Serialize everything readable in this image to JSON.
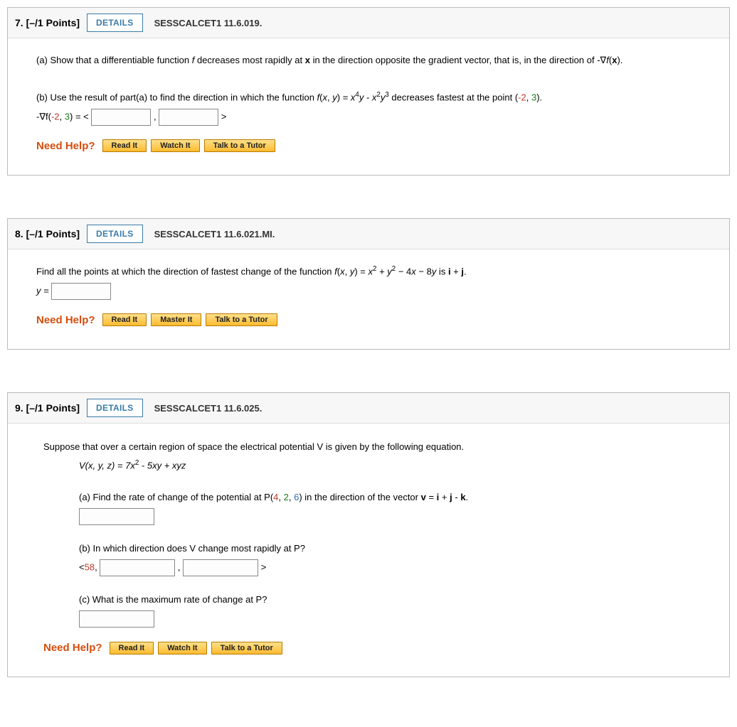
{
  "labels": {
    "details": "DETAILS",
    "need_help": "Need Help?",
    "read_it": "Read It",
    "watch_it": "Watch It",
    "master_it": "Master It",
    "talk_tutor": "Talk to a Tutor"
  },
  "q7": {
    "header_num": "7.",
    "points": "[–/1 Points]",
    "source": "SESSCALCET1 11.6.019.",
    "part_a_pre": "(a) Show that a differentiable function ",
    "part_a_mid": " decreases most rapidly at ",
    "part_a_post": " in the direction opposite the gradient vector, that is, in the direction of ",
    "part_a_end": ".",
    "part_b_pre": "(b) Use the result of part(a) to find the direction in which the function ",
    "part_b_mid": " decreases fastest at the point (",
    "part_b_end": ").",
    "eq_prefix": "-∇f(",
    "eq_mid": ") = < ",
    "eq_comma": " , ",
    "eq_close": " >",
    "p_neg": "-2",
    "p_pos": "3"
  },
  "q8": {
    "header_num": "8.",
    "points": "[–/1 Points]",
    "source": "SESSCALCET1 11.6.021.MI.",
    "body_pre": "Find all the points at which the direction of fastest change of the function ",
    "body_post": " is ",
    "body_end": ".",
    "y_eq": "y = "
  },
  "q9": {
    "header_num": "9.",
    "points": "[–/1 Points]",
    "source": "SESSCALCET1 11.6.025.",
    "intro": "Suppose that over a certain region of space the electrical potential V is given by the following equation.",
    "eq": "V(x, y, z) = 7x",
    "eq2": " - 5xy + xyz",
    "a_pre": "(a) Find the rate of change of the potential at P(",
    "a_post": ") in the direction of the vector ",
    "a_end": ".",
    "p1": "4",
    "p2": "2",
    "p3": "6",
    "b": "(b) In which direction does V change most rapidly at P?",
    "b_open": "<",
    "b_val": "58",
    "b_comma1": ", ",
    "b_comma2": " , ",
    "b_close": " >",
    "c": "(c) What is the maximum rate of change at P?"
  }
}
